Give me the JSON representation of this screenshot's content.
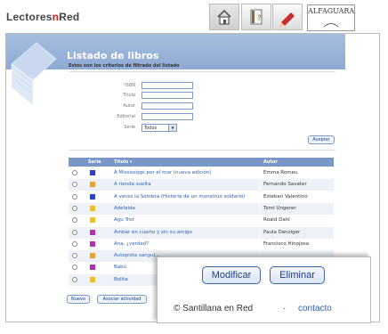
{
  "topbar": {
    "logo_part1": "Lectores",
    "logo_part2": "Red",
    "logo_full": "LectoresRed",
    "nav_icons": [
      "home-icon",
      "book-question-icon",
      "pencil-icon"
    ],
    "brand_name": "ALFAGUARA",
    "brand_sub": "INFANTIL Y JUVENIL"
  },
  "page": {
    "title": "Listado de libros",
    "subtitle": "Estos son los criterios de filtrado del listado"
  },
  "filters": {
    "isbn_label": "ISBN",
    "titulo_label": "Título",
    "autor_label": "Autor",
    "editorial_label": "Editorial",
    "serie_label": "Serie",
    "serie_value": "Todos",
    "accept_label": "Aceptar"
  },
  "table": {
    "headers": [
      "Serie",
      "Título ▾",
      "Autor"
    ],
    "rows": [
      {
        "color": "#2e3fc8",
        "title": "A Mississippi por el mar (nueva edición)",
        "author": "Emma Romeu"
      },
      {
        "color": "#f0a030",
        "title": "A rienda suelta",
        "author": "Fernando Savater"
      },
      {
        "color": "#2e3fc8",
        "title": "A veces la Sombra (Historia de un monstruo solitario)",
        "author": "Esteban Valentino"
      },
      {
        "color": "#f0c020",
        "title": "Adelaida",
        "author": "Tomi Ungerer"
      },
      {
        "color": "#f0c020",
        "title": "Agu Trot",
        "author": "Roald Dahl"
      },
      {
        "color": "#b030b0",
        "title": "Ámbar en cuarto y sin su amigo",
        "author": "Paula Danziger"
      },
      {
        "color": "#b030b0",
        "title": "Ana, ¿verdad?",
        "author": "Francisco Hinojosa"
      },
      {
        "color": "#f0a030",
        "title": "Autopista sangui...",
        "author": ""
      },
      {
        "color": "#b030b0",
        "title": "Babú",
        "author": ""
      },
      {
        "color": "#f0c020",
        "title": "Bolita",
        "author": ""
      }
    ]
  },
  "bottom": {
    "new_label": "Nuevo",
    "assoc_label": "Asociar actividad"
  },
  "popup": {
    "modify_label": "Modificar",
    "delete_label": "Eliminar",
    "copyright": "© Santillana en Red",
    "separator": "·",
    "contact": "contacto"
  }
}
